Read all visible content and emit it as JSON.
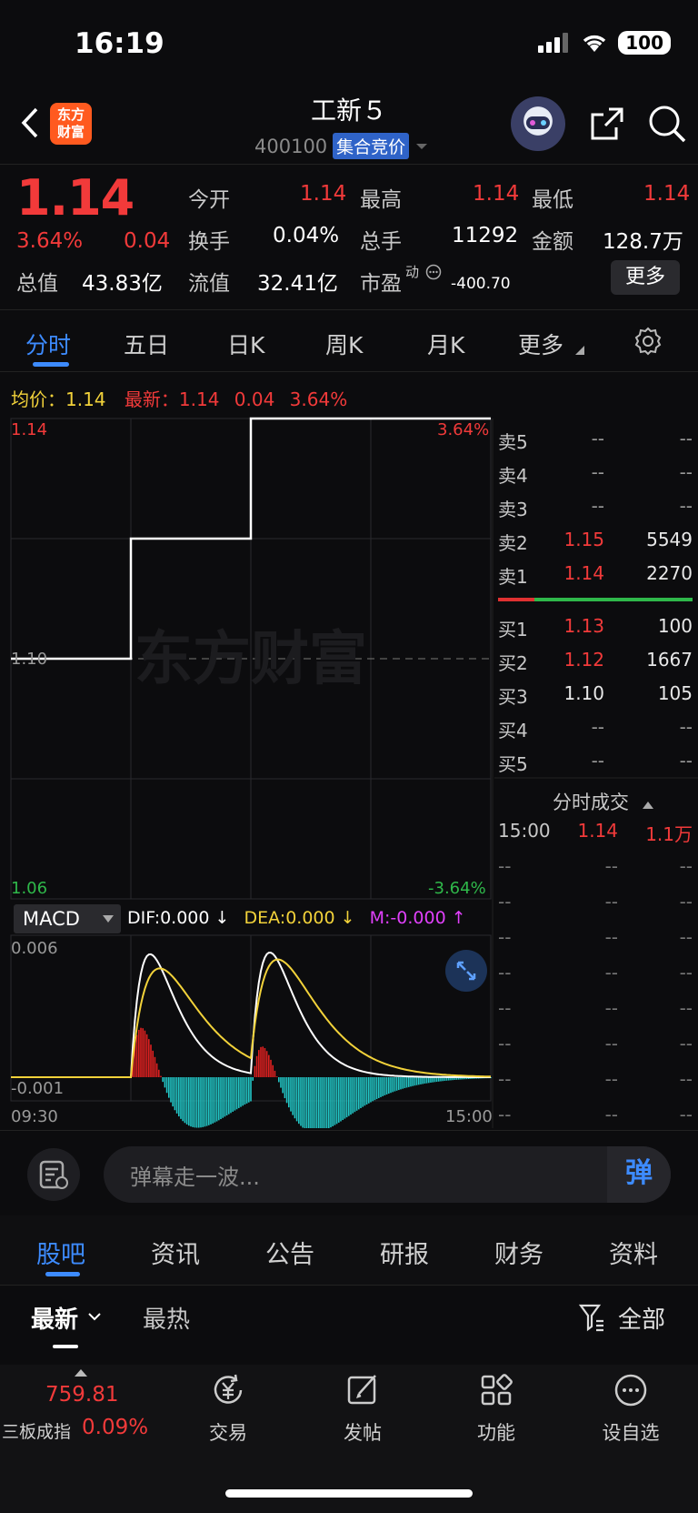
{
  "status_bar": {
    "time": "16:19",
    "battery": "100"
  },
  "header": {
    "logo_text": [
      "东方",
      "财富"
    ],
    "stock_name": "工新５",
    "stock_code": "400100",
    "badge": "集合竞价"
  },
  "quote": {
    "price": "1.14",
    "change_pct": "3.64%",
    "change": "0.04",
    "fields": [
      {
        "label": "今开",
        "value": "1.14",
        "color": "red"
      },
      {
        "label": "最高",
        "value": "1.14",
        "color": "red"
      },
      {
        "label": "最低",
        "value": "1.14",
        "color": "red"
      },
      {
        "label": "换手",
        "value": "0.04%",
        "color": "white"
      },
      {
        "label": "总手",
        "value": "11292",
        "color": "white"
      },
      {
        "label": "金额",
        "value": "128.7万",
        "color": "white"
      },
      {
        "label": "总值",
        "value": "43.83亿",
        "color": "white"
      },
      {
        "label": "流值",
        "value": "32.41亿",
        "color": "white"
      },
      {
        "label": "市盈",
        "value": "-400.70",
        "color": "white"
      }
    ],
    "pe_superscript": "动",
    "more_button": "更多"
  },
  "period_tabs": [
    "分时",
    "五日",
    "日K",
    "周K",
    "月K",
    "更多"
  ],
  "legend": {
    "avg_label": "均价：",
    "avg_value": "1.14",
    "last_label": "最新：",
    "last_value": "1.14",
    "last_change": "0.04",
    "last_pct": "3.64%"
  },
  "chart_data": [
    {
      "type": "line",
      "title": "",
      "x_range": [
        "09:30",
        "15:00"
      ],
      "ylim": [
        1.06,
        1.14
      ],
      "y_ticks": {
        "top": "1.14",
        "mid": "1.10",
        "bottom": "1.06"
      },
      "pct_ticks": {
        "top": "3.64%",
        "bottom": "-3.64%"
      },
      "series": [
        {
          "x": [
            0,
            0.25,
            0.25,
            0.5,
            0.5,
            1.0
          ],
          "values": [
            1.1,
            1.1,
            1.12,
            1.12,
            1.14,
            1.14
          ]
        }
      ],
      "watermark": "东方财富",
      "x_labels": [
        "09:30",
        "15:00"
      ]
    },
    {
      "type": "line",
      "title": "MACD",
      "indicator_header": {
        "dif": "DIF:0.000 ↓",
        "dea": "DEA:0.000 ↓",
        "m": "M:-0.000 ↑"
      },
      "y_ticks": {
        "top": "0.006",
        "bottom": "-0.001"
      },
      "ylim": [
        -0.001,
        0.006
      ]
    }
  ],
  "order_book": {
    "asks": [
      {
        "label": "卖5",
        "price": "--",
        "volume": "--",
        "color": "gray"
      },
      {
        "label": "卖4",
        "price": "--",
        "volume": "--",
        "color": "gray"
      },
      {
        "label": "卖3",
        "price": "--",
        "volume": "--",
        "color": "gray"
      },
      {
        "label": "卖2",
        "price": "1.15",
        "volume": "5549",
        "color": "red"
      },
      {
        "label": "卖1",
        "price": "1.14",
        "volume": "2270",
        "color": "red"
      }
    ],
    "bids": [
      {
        "label": "买1",
        "price": "1.13",
        "volume": "100",
        "color": "red"
      },
      {
        "label": "买2",
        "price": "1.12",
        "volume": "1667",
        "color": "red"
      },
      {
        "label": "买3",
        "price": "1.10",
        "volume": "105",
        "color": "white"
      },
      {
        "label": "买4",
        "price": "--",
        "volume": "--",
        "color": "gray"
      },
      {
        "label": "买5",
        "price": "--",
        "volume": "--",
        "color": "gray"
      }
    ],
    "ticks_title": "分时成交",
    "ticks": [
      {
        "time": "15:00",
        "price": "1.14",
        "volume": "1.1万"
      }
    ],
    "empty_rows": 8
  },
  "barrage": {
    "placeholder": "弹幕走一波...",
    "send_label": "弹"
  },
  "content_tabs": [
    "股吧",
    "资讯",
    "公告",
    "研报",
    "财务",
    "资料"
  ],
  "sub_tabs": {
    "latest": "最新",
    "hot": "最热",
    "filter": "全部"
  },
  "bottom_nav": {
    "index_value": "759.81",
    "index_name": "三板成指",
    "index_pct": "0.09%",
    "items": [
      "交易",
      "发帖",
      "功能",
      "设自选"
    ]
  },
  "colors": {
    "up": "#f23a3a",
    "down": "#2fb84a",
    "accent": "#3d8bff",
    "avg": "#f2d23a"
  }
}
